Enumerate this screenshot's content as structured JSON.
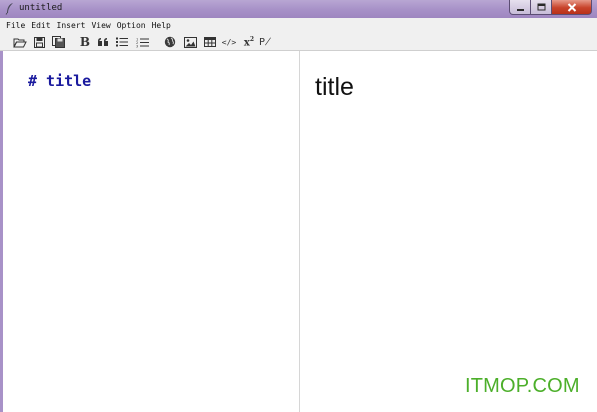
{
  "window": {
    "title": "untitled",
    "controls": {
      "minimize": "minimize-icon",
      "maximize": "maximize-icon",
      "close": "close-icon"
    }
  },
  "menubar": {
    "items": [
      "File",
      "Edit",
      "Insert",
      "View",
      "Option",
      "Help"
    ]
  },
  "toolbar": {
    "buttons": [
      {
        "name": "open",
        "icon": "folder-open-icon"
      },
      {
        "name": "save",
        "icon": "save-icon"
      },
      {
        "name": "save-as",
        "icon": "save-as-icon"
      },
      {
        "name": "bold",
        "label": "B"
      },
      {
        "name": "quote",
        "icon": "quote-icon"
      },
      {
        "name": "unordered-list",
        "icon": "bullet-list-icon"
      },
      {
        "name": "ordered-list",
        "icon": "numbered-list-icon"
      },
      {
        "name": "link",
        "icon": "globe-icon"
      },
      {
        "name": "image",
        "icon": "image-icon"
      },
      {
        "name": "table",
        "icon": "table-icon"
      },
      {
        "name": "code",
        "label": "</>"
      },
      {
        "name": "superscript",
        "label": "x",
        "sup": "2"
      },
      {
        "name": "strikethrough",
        "label": "P̸"
      }
    ]
  },
  "editor": {
    "text": "# title"
  },
  "preview": {
    "heading": "title"
  },
  "watermark": {
    "text": "ITMOP.COM",
    "color": "#4caf2a"
  },
  "colors": {
    "titlebar": "#a892c8",
    "editor_text": "#1a1a9e",
    "close_button": "#c8432b"
  }
}
